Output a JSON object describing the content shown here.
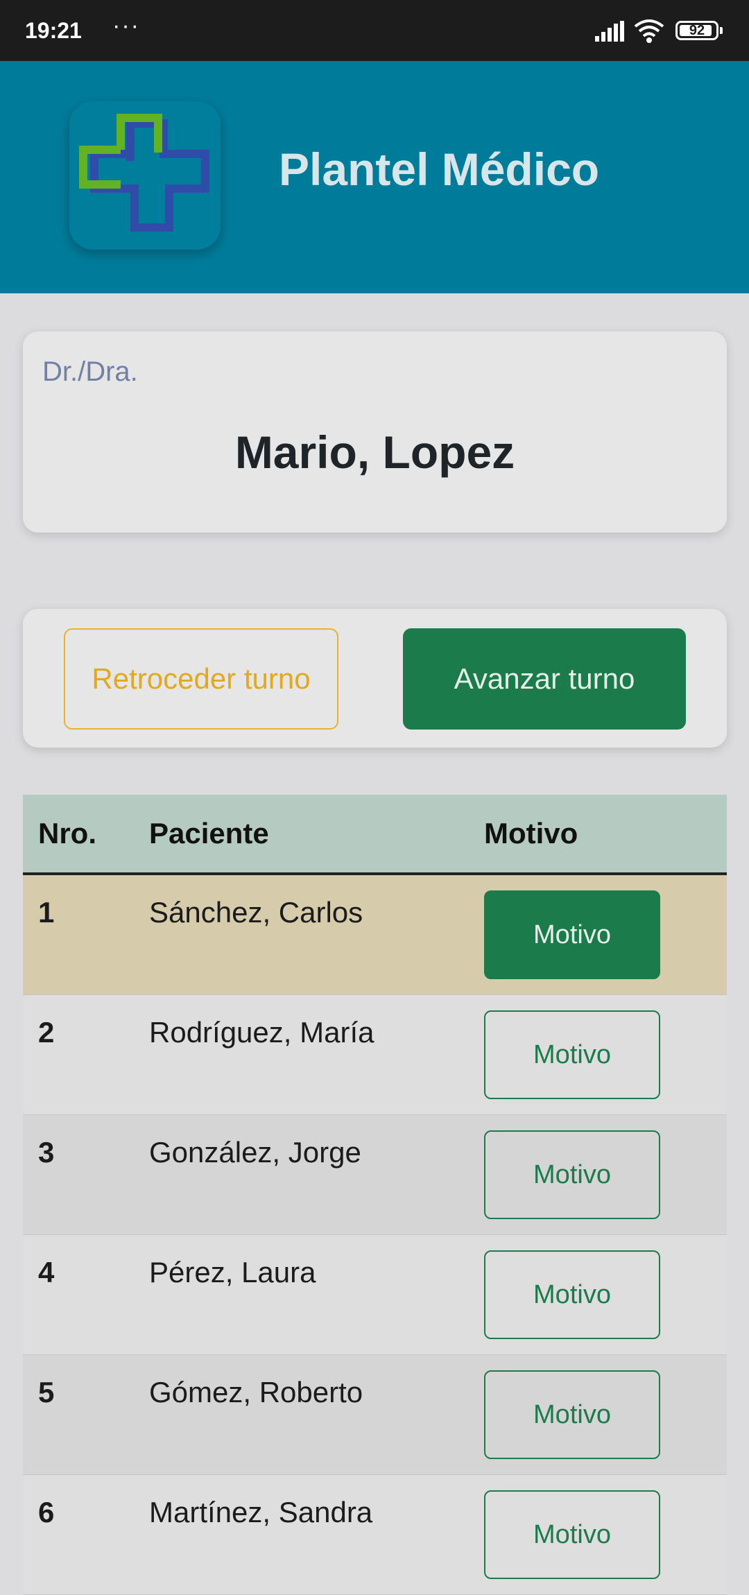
{
  "status_bar": {
    "time": "19:21",
    "dots": "···",
    "battery": "92",
    "battery_level_percent": 92
  },
  "header": {
    "title": "Plantel Médico",
    "logo_icon": "medical-cross-icon"
  },
  "doctor": {
    "prefix": "Dr./Dra.",
    "name": "Mario, Lopez"
  },
  "turn_controls": {
    "back_label": "Retroceder turno",
    "next_label": "Avanzar turno"
  },
  "table": {
    "headers": {
      "number": "Nro.",
      "patient": "Paciente",
      "reason": "Motivo"
    },
    "rows": [
      {
        "number": "1",
        "patient": "Sánchez, Carlos",
        "button": "Motivo",
        "active": true
      },
      {
        "number": "2",
        "patient": "Rodríguez, María",
        "button": "Motivo",
        "active": false
      },
      {
        "number": "3",
        "patient": "González, Jorge",
        "button": "Motivo",
        "active": false
      },
      {
        "number": "4",
        "patient": "Pérez, Laura",
        "button": "Motivo",
        "active": false
      },
      {
        "number": "5",
        "patient": "Gómez, Roberto",
        "button": "Motivo",
        "active": false
      },
      {
        "number": "6",
        "patient": "Martínez, Sandra",
        "button": "Motivo",
        "active": false
      }
    ]
  },
  "colors": {
    "header_bg": "#007c9b",
    "primary_green": "#1b7b4b",
    "warning_yellow": "#e8b22c",
    "active_row": "#d6cbab",
    "table_header": "#b5cbc1"
  }
}
